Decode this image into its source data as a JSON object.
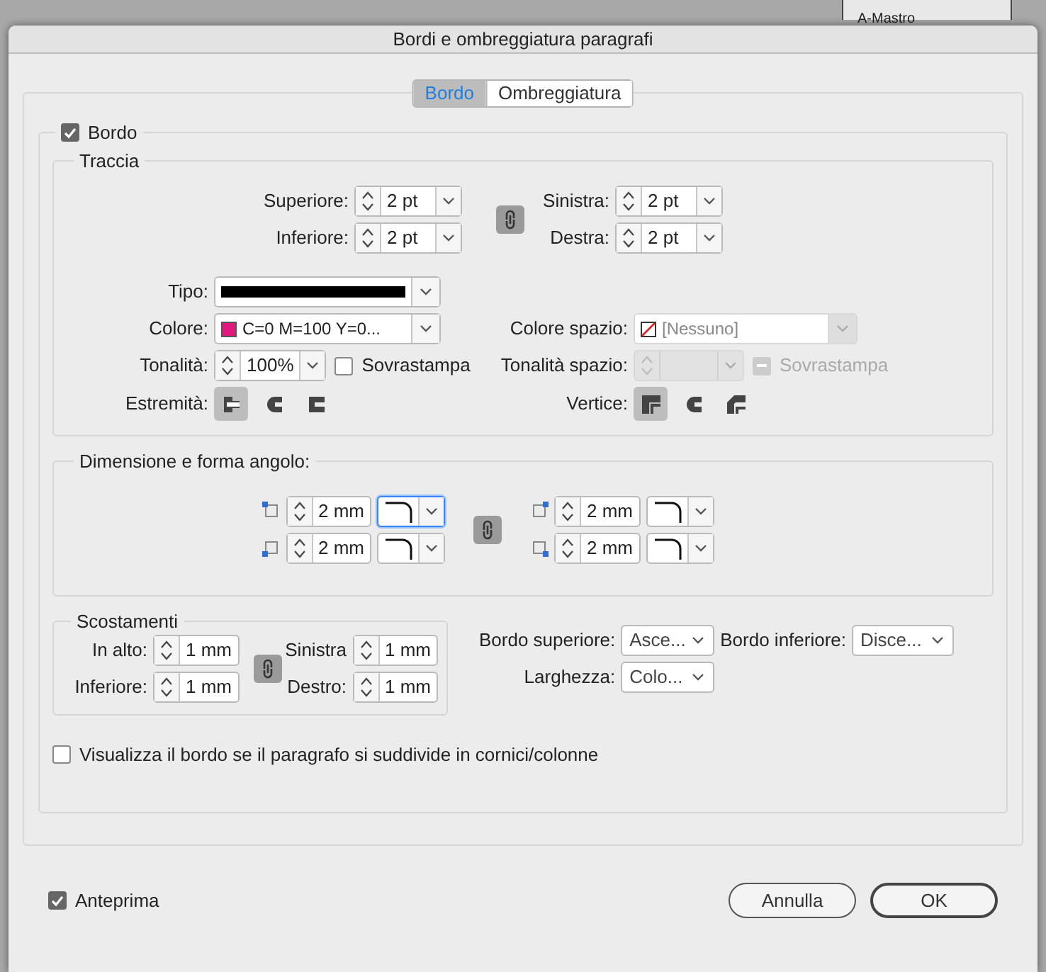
{
  "background": {
    "panel_label": "A-Mastro"
  },
  "window": {
    "title": "Bordi e ombreggiatura paragrafi"
  },
  "tabs": [
    {
      "label": "Bordo",
      "selected": true
    },
    {
      "label": "Ombreggiatura",
      "selected": false
    }
  ],
  "border": {
    "label": "Bordo",
    "checked": true
  },
  "stroke": {
    "title": "Traccia",
    "weights_left": [
      {
        "label": "Superiore:",
        "value": "2 pt"
      },
      {
        "label": "Inferiore:",
        "value": "2 pt"
      }
    ],
    "weights_right": [
      {
        "label": "Sinistra:",
        "value": "2 pt"
      },
      {
        "label": "Destra:",
        "value": "2 pt"
      }
    ],
    "type": {
      "label": "Tipo:"
    },
    "color": {
      "label": "Colore:",
      "value": "C=0 M=100 Y=0...",
      "color": "#e0197d"
    },
    "gap_color": {
      "label": "Colore spazio:",
      "value": "[Nessuno]",
      "disabled": true
    },
    "tint": {
      "label": "Tonalità:",
      "value": "100%"
    },
    "overprint": {
      "label": "Sovrastampa",
      "checked": false,
      "disabled": false
    },
    "gap_tint": {
      "label": "Tonalità spazio:",
      "disabled": true
    },
    "gap_overprint": {
      "label": "Sovrastampa",
      "checked": false,
      "disabled": true
    },
    "cap": {
      "label": "Estremità:",
      "options": [
        {
          "kind": "butt",
          "selected": true
        },
        {
          "kind": "round",
          "selected": false
        },
        {
          "kind": "projecting",
          "selected": false
        }
      ]
    },
    "join": {
      "label": "Vertice:",
      "options": [
        {
          "kind": "miter",
          "selected": true
        },
        {
          "kind": "round",
          "selected": false
        },
        {
          "kind": "bevel",
          "selected": false
        }
      ]
    }
  },
  "corners": {
    "title": "Dimensione e forma angolo:",
    "items": [
      {
        "kind": "top-left",
        "value": "2 mm",
        "focused": true
      },
      {
        "kind": "bottom-left",
        "value": "2 mm",
        "focused": false
      },
      {
        "kind": "top-right",
        "value": "2 mm",
        "focused": false
      },
      {
        "kind": "bottom-right",
        "value": "2 mm",
        "focused": false
      }
    ]
  },
  "offsets": {
    "title": "Scostamenti",
    "left": [
      {
        "label": "In alto:",
        "value": "1 mm"
      },
      {
        "label": "Inferiore:",
        "value": "1 mm"
      }
    ],
    "right": [
      {
        "label": "Sinistra",
        "value": "1 mm"
      },
      {
        "label": "Destro:",
        "value": "1 mm"
      }
    ]
  },
  "top_edge": {
    "label": "Bordo superiore:",
    "value": "Asce..."
  },
  "bottom_edge": {
    "label": "Bordo inferiore:",
    "value": "Disce..."
  },
  "width": {
    "label": "Larghezza:",
    "value": "Colo..."
  },
  "split_option": {
    "label": "Visualizza il bordo se il paragrafo si suddivide in cornici/colonne",
    "checked": false
  },
  "preview": {
    "label": "Anteprima",
    "checked": true
  },
  "buttons": [
    {
      "label": "Annulla",
      "default": false
    },
    {
      "label": "OK",
      "default": true
    }
  ]
}
